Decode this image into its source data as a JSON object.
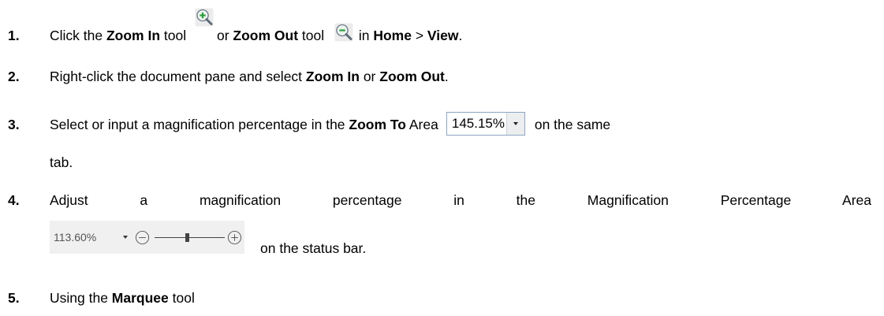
{
  "colors": {
    "text": "#000000",
    "icon_green": "#2e9e3e",
    "lens_stroke": "#7b8894",
    "combo_border": "#8da5c3",
    "status_bg": "#f0f0f0",
    "status_text": "#555555"
  },
  "icons": {
    "zoom_in": "zoom-in-icon",
    "zoom_out": "zoom-out-icon",
    "combo_dropdown": "chevron-down-icon",
    "status_dropdown": "chevron-down-icon",
    "status_minus": "circle-minus-icon",
    "status_plus": "circle-plus-icon"
  },
  "items": [
    {
      "number": "1.",
      "text_a": "Click the ",
      "bold_a": "Zoom In",
      "text_b": " tool ",
      "text_c": "or ",
      "bold_b": "Zoom Out",
      "text_d": " tool ",
      "text_e": " in ",
      "bold_c": "Home",
      "text_f": " > ",
      "bold_d": "View",
      "text_g": "."
    },
    {
      "number": "2.",
      "text_a": "Right-click the document pane and select ",
      "bold_a": "Zoom In",
      "text_b": " or ",
      "bold_b": "Zoom Out",
      "text_c": "."
    },
    {
      "number": "3.",
      "text_a": "Select or input a magnification percentage in the ",
      "bold_a": "Zoom To",
      "text_b": " Area",
      "zoom_to_value": "145.15%",
      "text_c": "on the same",
      "text_d": "tab."
    },
    {
      "number": "4.",
      "text_a": "Adjust a magnification percentage in the Magnification Percentage Area",
      "zoom_percentage": "113.60%",
      "slider_level": 0.47,
      "text_b": "on the status bar."
    },
    {
      "number": "5.",
      "text_a": "Using the ",
      "bold_a": "Marquee",
      "text_b": " tool"
    }
  ]
}
